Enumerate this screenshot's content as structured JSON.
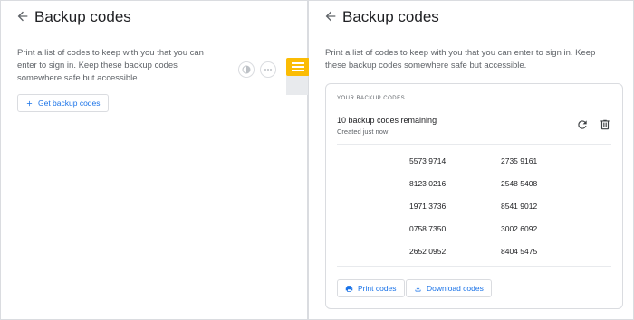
{
  "left_panel": {
    "title": "Backup codes",
    "description": "Print a list of codes to keep with you that you can enter to sign in. Keep these backup codes somewhere safe but accessible.",
    "get_button_label": "Get backup codes",
    "get_button_icon": "plus-icon"
  },
  "right_panel": {
    "title": "Backup codes",
    "description": "Print a list of codes to keep with you that you can enter to sign in. Keep these backup codes somewhere safe but accessible.",
    "codes_card": {
      "label": "YOUR BACKUP CODES",
      "remaining": "10 backup codes remaining",
      "created": "Created just now",
      "rows": [
        [
          "5573 9714",
          "2735 9161"
        ],
        [
          "8123 0216",
          "2548 5408"
        ],
        [
          "1971 3736",
          "8541 9012"
        ],
        [
          "0758 7350",
          "3002 6092"
        ],
        [
          "2652 0952",
          "8404 5475"
        ]
      ],
      "print_label": "Print codes",
      "download_label": "Download codes"
    }
  },
  "colors": {
    "accent": "#1a73e8",
    "text": "#202124",
    "secondary_text": "#5f6368",
    "border": "#dadce0",
    "illustration_note": "#fbbc04"
  }
}
